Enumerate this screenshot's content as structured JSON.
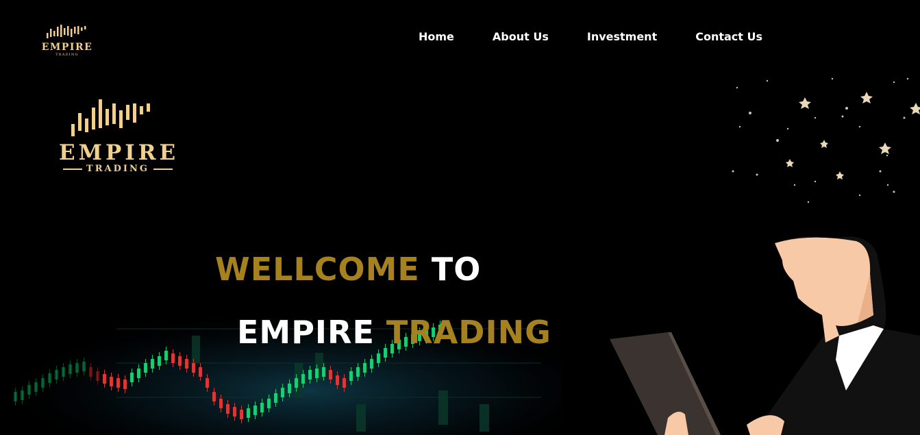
{
  "brand": {
    "name": "EMPIRE",
    "tagline": "TRADING",
    "logo_color": "#f1d08f"
  },
  "nav": {
    "items": [
      {
        "label": "Home"
      },
      {
        "label": "About Us"
      },
      {
        "label": "Investment"
      },
      {
        "label": "Contact Us"
      }
    ]
  },
  "hero": {
    "line1_gold": "WELLCOME",
    "line1_white": "TO",
    "line2_white": "EMPIRE",
    "line2_gold": "TRADING",
    "gold_color": "#a5811f"
  },
  "decor": {
    "chart_icon": "candlestick-chart-image",
    "illustration": "woman-with-laptop-illustration",
    "stars": "star-sparkles"
  }
}
